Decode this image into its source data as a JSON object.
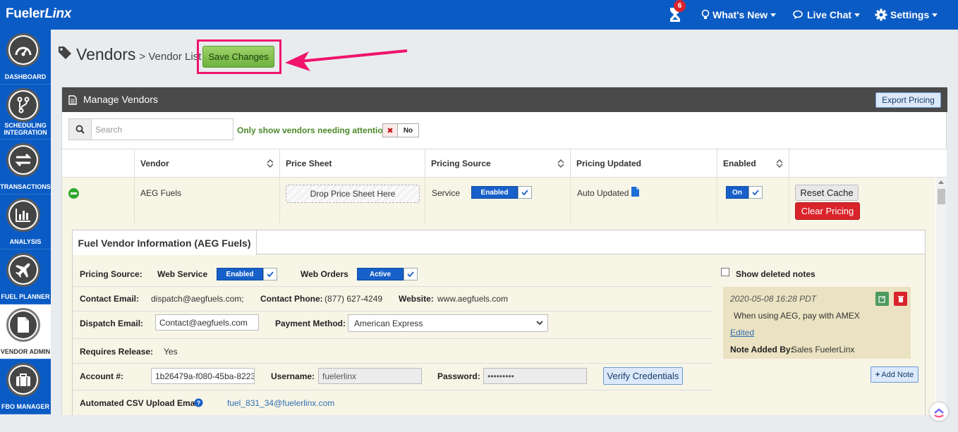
{
  "topbar": {
    "logo_main": "Fueler",
    "logo_italic": "Linx",
    "notification_count": "6",
    "whats_new": "What's New",
    "live_chat": "Live Chat",
    "settings": "Settings"
  },
  "sidebar": {
    "items": [
      {
        "label": "DASHBOARD",
        "icon": "dashboard-gauge-icon"
      },
      {
        "label": "SCHEDULING INTEGRATION",
        "icon": "scheduling-branch-icon"
      },
      {
        "label": "TRANSACTIONS",
        "icon": "transactions-arrows-icon"
      },
      {
        "label": "ANALYSIS",
        "icon": "analysis-chart-icon"
      },
      {
        "label": "FUEL PLANNER",
        "icon": "airplane-icon"
      },
      {
        "label": "VENDOR ADMIN",
        "icon": "document-icon"
      },
      {
        "label": "FBO MANAGER",
        "icon": "briefcase-icon"
      }
    ]
  },
  "header": {
    "title": "Vendors",
    "subtitle": "> Vendor List",
    "save_label": "Save Changes"
  },
  "panel": {
    "title": "Manage Vendors",
    "export_label": "Export Pricing",
    "search_placeholder": "Search",
    "attention_label": "Only show vendors needing attention",
    "attention_toggle": "No"
  },
  "table": {
    "columns": [
      "Vendor",
      "Price Sheet",
      "Pricing Source",
      "Pricing Updated",
      "Enabled"
    ],
    "row": {
      "vendor": "AEG Fuels",
      "price_sheet": "Drop Price Sheet Here",
      "pricing_source": "Service",
      "pricing_source_toggle": "Enabled",
      "pricing_updated": "Auto Updated",
      "enabled_toggle": "On",
      "reset_label": "Reset Cache",
      "clear_label": "Clear Pricing"
    }
  },
  "details": {
    "tab": "Fuel Vendor Information (AEG Fuels)",
    "pricing_source_label": "Pricing Source:",
    "web_service_label": "Web Service",
    "web_service_toggle": "Enabled",
    "web_orders_label": "Web Orders",
    "web_orders_toggle": "Active",
    "contact_email_label": "Contact Email:",
    "contact_email": "dispatch@aegfuels.com;",
    "contact_phone_label": "Contact Phone:",
    "contact_phone": "(877) 627-4249",
    "website_label": "Website:",
    "website": "www.aegfuels.com",
    "dispatch_email_label": "Dispatch Email:",
    "dispatch_email": "Contact@aegfuels.com",
    "payment_method_label": "Payment Method:",
    "payment_method": "American Express",
    "requires_release_label": "Requires Release:",
    "requires_release": "Yes",
    "account_label": "Account #:",
    "account": "1b26479a-f080-45ba-8223",
    "username_label": "Username:",
    "username": "fuelerlinx",
    "password_label": "Password:",
    "password": "•••••••••",
    "verify_label": "Verify Credentials",
    "csv_label": "Automated CSV Upload Email",
    "csv_email": "fuel_831_34@fuelerlinx.com"
  },
  "notes": {
    "show_deleted_label": "Show deleted notes",
    "date": "2020-05-08 16:28 PDT",
    "text": "When using AEG, pay with AMEX",
    "edited": "Edited",
    "added_by_label": "Note Added By:",
    "added_by": "Sales FuelerLinx",
    "add_note_label": "Add Note"
  },
  "colors": {
    "brand_blue": "#0b5bc4",
    "save_green": "#6db33f",
    "highlight_pink": "#f0146c",
    "danger_red": "#d9242b"
  }
}
